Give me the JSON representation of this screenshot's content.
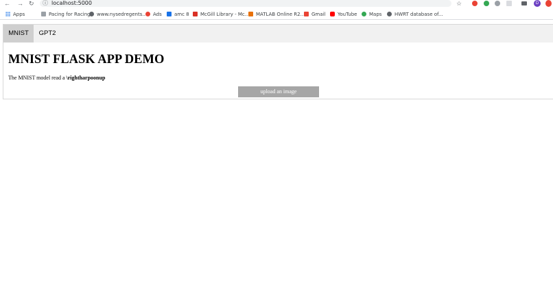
{
  "browser": {
    "url": "localhost:5000",
    "bookmarks": [
      {
        "label": "Apps",
        "icon": "apps-grid-icon"
      },
      {
        "label": "Pacing for Racing",
        "icon": "page-icon",
        "color": "#9aa0a6"
      },
      {
        "label": "www.nysedregents....",
        "icon": "globe-icon",
        "color": "#5f6368"
      },
      {
        "label": "Ads",
        "icon": "ads-icon",
        "color": "#ea4335"
      },
      {
        "label": "amc 8",
        "icon": "cube-icon",
        "color": "#1a73e8"
      },
      {
        "label": "McGill Library - Mc...",
        "icon": "mcgill-icon",
        "color": "#d93025"
      },
      {
        "label": "MATLAB Online R2...",
        "icon": "matlab-icon",
        "color": "#e8710a"
      },
      {
        "label": "Gmail",
        "icon": "gmail-icon",
        "color": "#ea4335"
      },
      {
        "label": "YouTube",
        "icon": "youtube-icon",
        "color": "#ff0000"
      },
      {
        "label": "Maps",
        "icon": "maps-icon",
        "color": "#34a853"
      },
      {
        "label": "HWRT database of...",
        "icon": "globe-icon",
        "color": "#5f6368"
      }
    ],
    "profile_initial": "D"
  },
  "app": {
    "tabs": [
      {
        "label": "MNIST",
        "active": true
      },
      {
        "label": "GPT2",
        "active": false
      }
    ],
    "title": "MNIST FLASK APP DEMO",
    "result_prefix": "The MNIST model read a ",
    "result_value": "\\rightharpoonup",
    "upload_label": "upload an image"
  }
}
